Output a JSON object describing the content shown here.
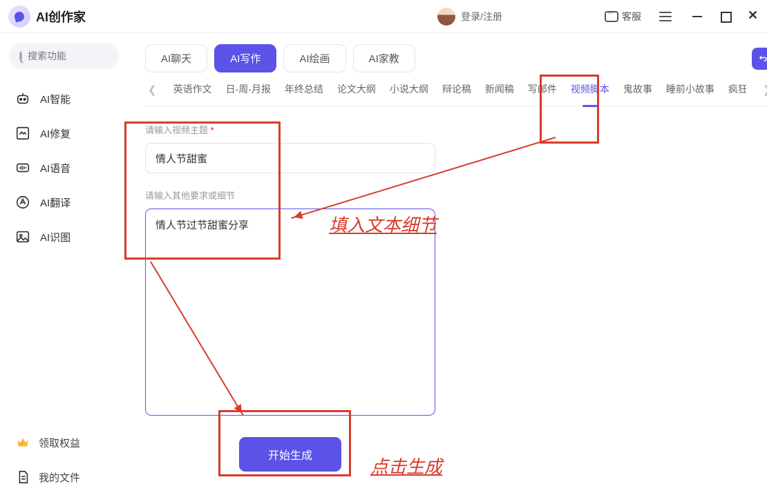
{
  "app": {
    "title": "AI创作家"
  },
  "header": {
    "login": "登录/注册",
    "customer_service": "客服"
  },
  "sidebar": {
    "search_placeholder": "搜索功能",
    "items": [
      "AI智能",
      "AI修复",
      "AI语音",
      "AI翻译",
      "AI识图"
    ],
    "benefits": "领取权益",
    "my_files": "我的文件"
  },
  "tabs": {
    "modes": [
      "AI聊天",
      "AI写作",
      "AI绘画",
      "AI家教"
    ],
    "active_index": 1
  },
  "categories": {
    "items": [
      "英语作文",
      "日-周-月报",
      "年终总结",
      "论文大纲",
      "小说大纲",
      "辩论稿",
      "新闻稿",
      "写邮件",
      "视频脚本",
      "鬼故事",
      "睡前小故事",
      "疯狂"
    ],
    "active_index": 8
  },
  "form": {
    "topic_label": "请输入视频主题",
    "required_mark": "*",
    "topic_value": "情人节甜蜜",
    "detail_label": "请输入其他要求或细节",
    "detail_value": "情人节过节甜蜜分享",
    "generate_btn": "开始生成"
  },
  "annotations": {
    "fill_detail": "填入文本细节",
    "click_generate": "点击生成"
  }
}
